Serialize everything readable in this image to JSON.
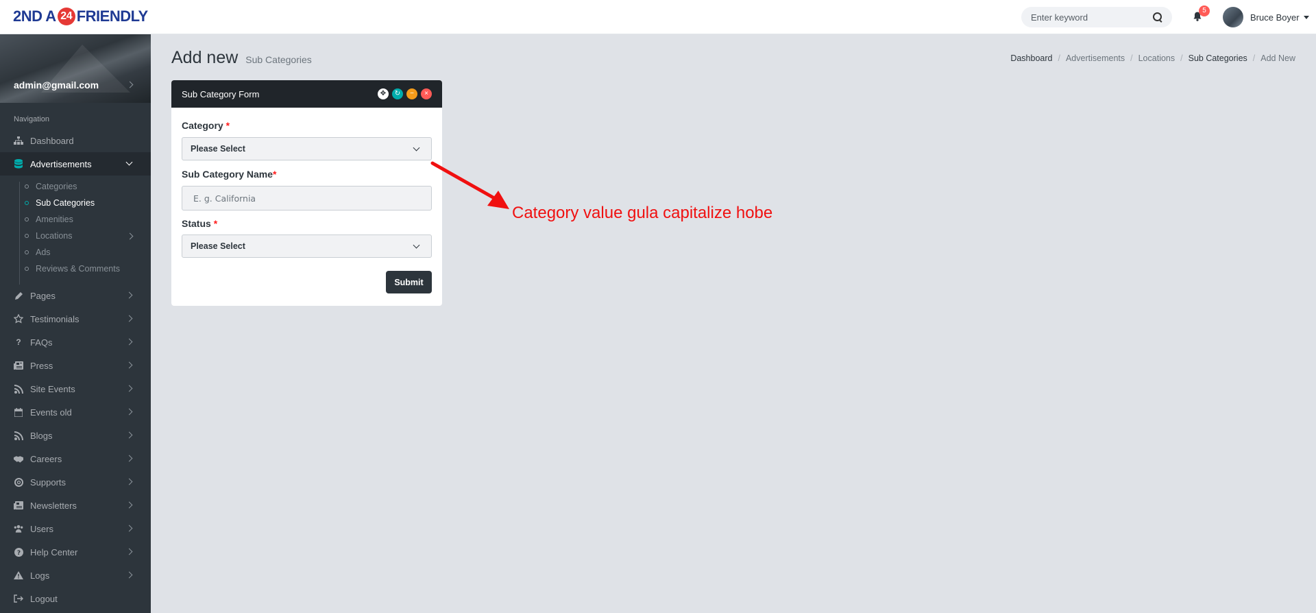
{
  "header": {
    "logo_left": "2ND A",
    "logo_badge": "24",
    "logo_right": "FRIENDLY",
    "search_placeholder": "Enter keyword",
    "notification_count": "5",
    "user_name": "Bruce Boyer"
  },
  "sidebar": {
    "profile_email": "admin@gmail.com",
    "nav_title": "Navigation",
    "items": [
      {
        "label": "Dashboard",
        "icon": "sitemap-icon"
      },
      {
        "label": "Advertisements",
        "icon": "database-icon",
        "active": true
      },
      {
        "label": "Pages",
        "icon": "pencil-icon"
      },
      {
        "label": "Testimonials",
        "icon": "star-icon"
      },
      {
        "label": "FAQs",
        "icon": "question-icon"
      },
      {
        "label": "Press",
        "icon": "newspaper-icon"
      },
      {
        "label": "Site Events",
        "icon": "rss-icon"
      },
      {
        "label": "Events old",
        "icon": "calendar-icon"
      },
      {
        "label": "Blogs",
        "icon": "rss-icon"
      },
      {
        "label": "Careers",
        "icon": "handshake-icon"
      },
      {
        "label": "Supports",
        "icon": "life-ring-icon"
      },
      {
        "label": "Newsletters",
        "icon": "newspaper-icon"
      },
      {
        "label": "Users",
        "icon": "users-icon"
      },
      {
        "label": "Help Center",
        "icon": "question-circle-icon"
      },
      {
        "label": "Logs",
        "icon": "warning-icon"
      },
      {
        "label": "Logout",
        "icon": "sign-out-icon"
      }
    ],
    "sub_items": [
      {
        "label": "Categories"
      },
      {
        "label": "Sub Categories",
        "active": true
      },
      {
        "label": "Amenities"
      },
      {
        "label": "Locations"
      },
      {
        "label": "Ads"
      },
      {
        "label": "Reviews & Comments"
      }
    ]
  },
  "page": {
    "title": "Add new",
    "subtitle": "Sub Categories",
    "breadcrumb": [
      "Dashboard",
      "Advertisements",
      "Locations",
      "Sub Categories",
      "Add New"
    ]
  },
  "form": {
    "panel_title": "Sub Category Form",
    "category_label": "Category",
    "category_value": "Please Select",
    "name_label": "Sub Category Name",
    "name_placeholder": "E. g. California",
    "status_label": "Status",
    "status_value": "Please Select",
    "required_mark": "*",
    "submit_label": "Submit"
  },
  "annotation": {
    "text": "Category value gula capitalize hobe",
    "color": "#f01010"
  },
  "colors": {
    "sidebar_bg": "#2d353c",
    "accent": "#00acac",
    "page_bg": "#dfe2e7"
  }
}
